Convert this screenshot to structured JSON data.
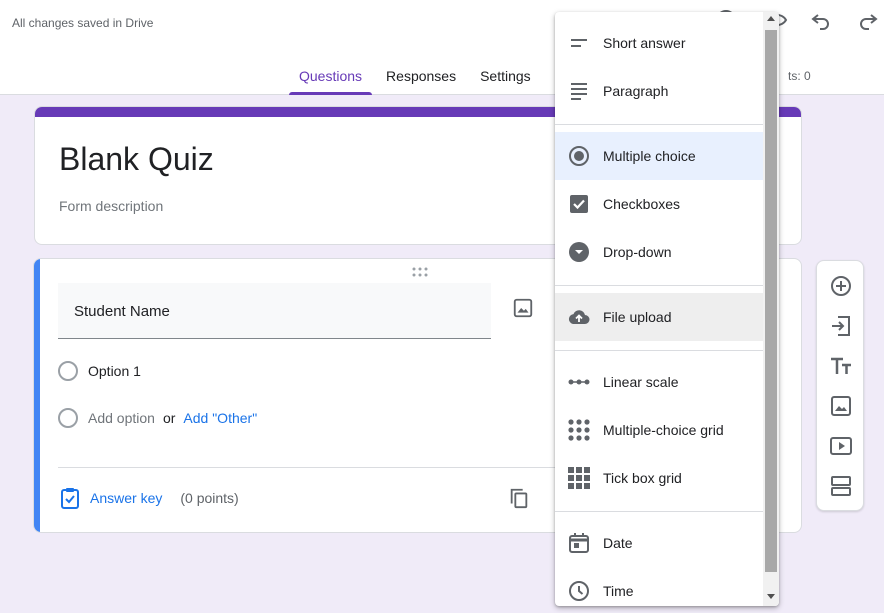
{
  "header": {
    "saved_status": "All changes saved in Drive",
    "tabs": [
      {
        "label": "Questions",
        "active": true
      },
      {
        "label": "Responses",
        "active": false
      },
      {
        "label": "Settings",
        "active": false
      }
    ],
    "points_total": "ts: 0"
  },
  "form": {
    "title": "Blank Quiz",
    "description_placeholder": "Form description",
    "question": {
      "title": "Student Name",
      "options": [
        "Option 1"
      ],
      "add_option": "Add option",
      "or": "or",
      "add_other": "Add \"Other\"",
      "answer_key": "Answer key",
      "points": "(0 points)"
    }
  },
  "menu": {
    "selected": "Multiple choice",
    "hovered": "File upload",
    "items": [
      {
        "label": "Short answer",
        "icon": "short-answer-icon"
      },
      {
        "label": "Paragraph",
        "icon": "paragraph-icon"
      },
      {
        "label": "Multiple choice",
        "icon": "radio-button-icon"
      },
      {
        "label": "Checkboxes",
        "icon": "checkbox-icon"
      },
      {
        "label": "Drop-down",
        "icon": "dropdown-circle-icon"
      },
      {
        "label": "File upload",
        "icon": "cloud-upload-icon"
      },
      {
        "label": "Linear scale",
        "icon": "linear-scale-icon"
      },
      {
        "label": "Multiple-choice grid",
        "icon": "dot-grid-icon"
      },
      {
        "label": "Tick box grid",
        "icon": "square-grid-icon"
      },
      {
        "label": "Date",
        "icon": "calendar-icon"
      },
      {
        "label": "Time",
        "icon": "clock-icon"
      }
    ]
  },
  "toolbar": [
    {
      "name": "add-question",
      "icon": "add-circle-icon"
    },
    {
      "name": "import-questions",
      "icon": "import-icon"
    },
    {
      "name": "add-title",
      "icon": "title-icon"
    },
    {
      "name": "add-image",
      "icon": "image-icon"
    },
    {
      "name": "add-video",
      "icon": "video-icon"
    },
    {
      "name": "add-section",
      "icon": "section-icon"
    }
  ],
  "colors": {
    "accent": "#673ab7",
    "background": "#f0ebf8",
    "link": "#1a73e8",
    "question_bar": "#4285f4"
  }
}
